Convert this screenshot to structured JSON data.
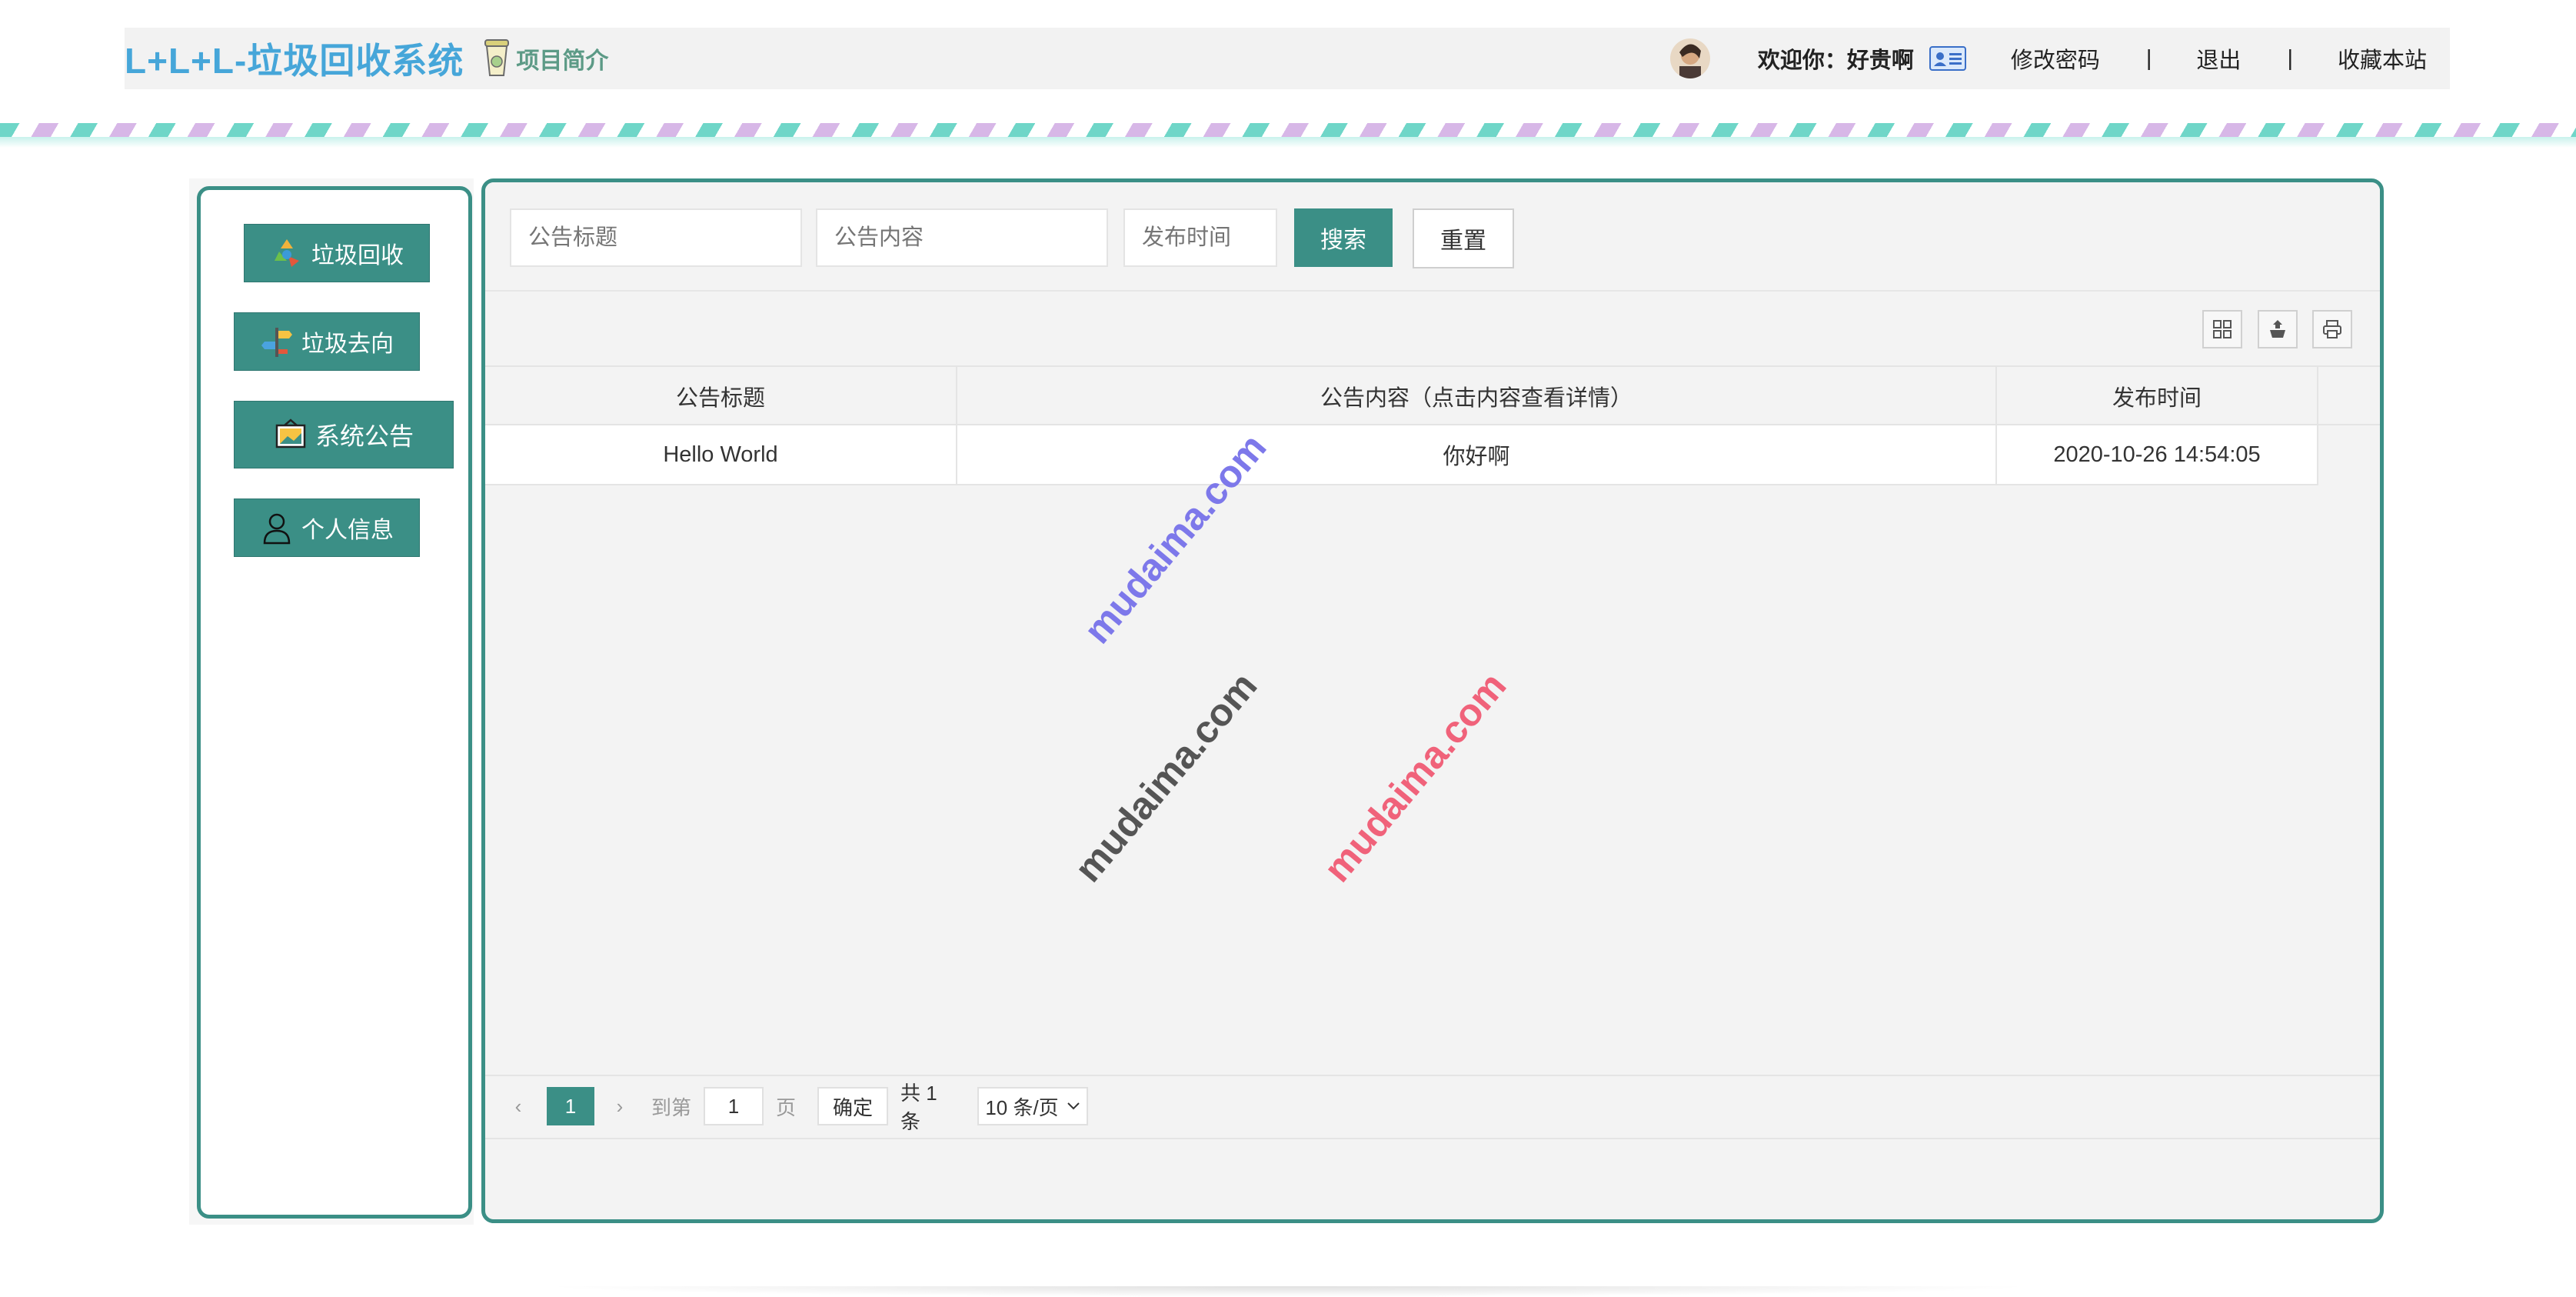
{
  "header": {
    "title": "L+L+L-垃圾回收系统",
    "intro_link": "项目简介",
    "welcome": "欢迎你：好贵啊",
    "change_password": "修改密码",
    "sep1": "|",
    "logout": "退出",
    "sep2": "|",
    "bookmark": "收藏本站"
  },
  "sidebar": {
    "items": [
      {
        "label": "垃圾回收",
        "icon": "recycle-icon"
      },
      {
        "label": "垃圾去向",
        "icon": "signpost-icon"
      },
      {
        "label": "系统公告",
        "icon": "notice-board-icon"
      },
      {
        "label": "个人信息",
        "icon": "user-icon"
      }
    ]
  },
  "search": {
    "title_placeholder": "公告标题",
    "content_placeholder": "公告内容",
    "time_placeholder": "发布时间",
    "search_label": "搜索",
    "reset_label": "重置"
  },
  "table": {
    "columns": [
      "公告标题",
      "公告内容（点击内容查看详情）",
      "发布时间"
    ],
    "rows": [
      [
        "Hello World",
        "你好啊",
        "2020-10-26 14:54:05"
      ]
    ]
  },
  "pager": {
    "prev": "‹",
    "current": "1",
    "next": "›",
    "goto_label": "到第",
    "page_input": "1",
    "page_unit": "页",
    "confirm": "确定",
    "total": "共 1 条",
    "page_size": "10 条/页"
  },
  "watermarks": [
    "mudaima.com",
    "mudaima.com",
    "mudaima.com"
  ],
  "colors": {
    "brand_title": "#46a6d9",
    "accent": "#3b8f86"
  }
}
